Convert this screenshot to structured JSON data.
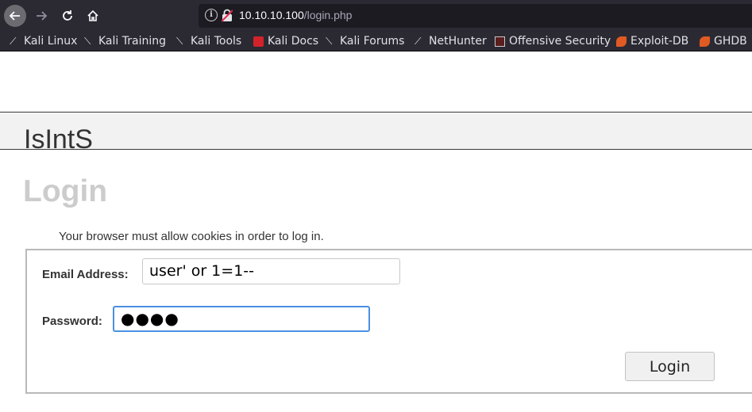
{
  "browser": {
    "url_host": "10.10.10.100",
    "url_path": "/login.php",
    "bookmarks": [
      {
        "label": "Kali Linux",
        "icon": "kali-dragon-icon"
      },
      {
        "label": "Kali Training",
        "icon": "kali-dragon-icon"
      },
      {
        "label": "Kali Tools",
        "icon": "kali-dragon-icon"
      },
      {
        "label": "Kali Docs",
        "icon": "kali-docs-icon"
      },
      {
        "label": "Kali Forums",
        "icon": "kali-dragon-icon"
      },
      {
        "label": "NetHunter",
        "icon": "nethunter-icon"
      },
      {
        "label": "Offensive Security",
        "icon": "offsec-icon"
      },
      {
        "label": "Exploit-DB",
        "icon": "exploit-db-icon"
      },
      {
        "label": "GHDB",
        "icon": "exploit-db-icon"
      }
    ]
  },
  "page": {
    "site_title": "IsIntS",
    "heading": "Login",
    "cookies_note": "Your browser must allow cookies in order to log in.",
    "email_label": "Email Address:",
    "email_value": "user' or 1=1--",
    "password_label": "Password:",
    "password_value": "●●●●",
    "submit_label": "Login"
  },
  "colors": {
    "chrome_bg": "#2b2a33",
    "banner_bg": "#f2f2f2",
    "heading": "#cccccc",
    "focus_border": "#4a90e2"
  }
}
